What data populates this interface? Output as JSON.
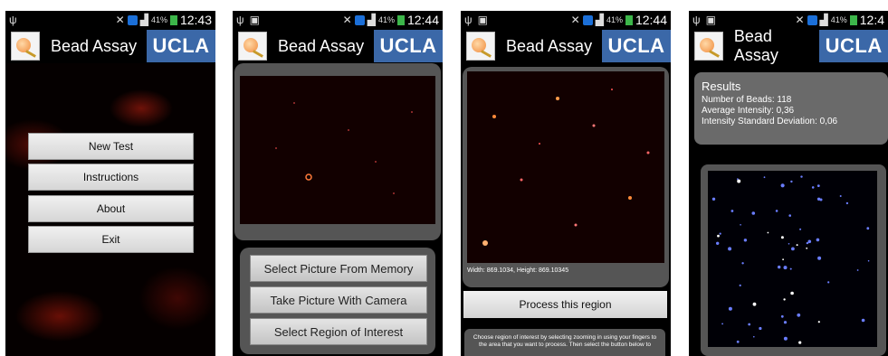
{
  "app": {
    "title": "Bead Assay",
    "logo_text": "UCLA",
    "brand_color": "#3b68a8"
  },
  "statusbar": {
    "battery_labels": [
      "41%",
      "41%",
      "41%",
      "41%"
    ],
    "times": [
      "12:43",
      "12:44",
      "12:44",
      "12:4"
    ],
    "icons": [
      "usb-icon",
      "image-icon",
      "mute-icon",
      "bluetooth-icon",
      "signal-icon",
      "battery-icon"
    ]
  },
  "screen1": {
    "menu": [
      "New Test",
      "Instructions",
      "About",
      "Exit"
    ]
  },
  "screen2": {
    "buttons": [
      "Select Picture From Memory",
      "Take Picture With Camera",
      "Select Region of Interest"
    ]
  },
  "screen3": {
    "dimensions": "Width: 869.1034, Height: 869.10345",
    "process_button": "Process this region",
    "hint": "Choose region of interest by selecting zooming in using your fingers to the area that you want to process. Then select the button below to"
  },
  "screen4": {
    "results_title": "Results",
    "number_of_beads": "Number of Beads:  118",
    "average_intensity": "Average Intensity:  0,36",
    "intensity_sd": "Intensity Standard Deviation: 0,06"
  }
}
